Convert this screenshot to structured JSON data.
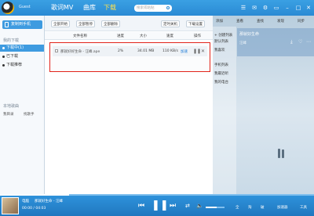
{
  "topbar": {
    "user": "Guest",
    "tabs": [
      {
        "label": "歌词MV",
        "active": false
      },
      {
        "label": "曲库",
        "active": false
      },
      {
        "label": "下载",
        "active": true
      }
    ],
    "search_placeholder": "搜索或粘贴"
  },
  "sidebar": {
    "phone_button": "复制到手机",
    "my_downloads_title": "我的下载",
    "items": [
      {
        "label": "下载中(1)",
        "active": true
      },
      {
        "label": "已下载",
        "active": false
      },
      {
        "label": "下载推荐",
        "active": false
      }
    ],
    "local_title": "本地歌曲",
    "tools": [
      "我目录",
      "找歌手"
    ]
  },
  "toolbar": {
    "start_all": "全部开始",
    "pause_all": "全部暂停",
    "delete_all": "全部删除",
    "scheduled_shutdown": "定时关机",
    "download_settings": "下载设置"
  },
  "table": {
    "headers": [
      "文件名称",
      "进度",
      "大小",
      "速度",
      "操作"
    ],
    "rows": [
      {
        "name": "那就好好生命 - 汪峰.ape",
        "progress": "2%",
        "size": "34.01 MB",
        "speed": "110 KB/s",
        "link": "加速"
      }
    ]
  },
  "right_panel": {
    "tabs": [
      "添加",
      "查看",
      "查找",
      "发现",
      "同步"
    ],
    "list_buttons": [
      "+ 创建列表",
      "默认列表",
      "我喜欢",
      "手机列表",
      "我最近听",
      "我的电台"
    ],
    "song": {
      "title": "那就好生命",
      "artist": "汪峰"
    }
  },
  "player": {
    "song": "那就好生命 - 汪峰",
    "source": "电脑",
    "time": "00:00 / 04:03",
    "progress_percent": 0.22,
    "volume_percent": 0.6,
    "right_tools": [
      "全",
      "淘",
      "破",
      "加速器",
      "工具"
    ]
  },
  "colors": {
    "accent": "#2a8ad4",
    "active_tab": "#ffe14d",
    "highlight_border": "#e2231a",
    "link": "#1a7ad8"
  }
}
